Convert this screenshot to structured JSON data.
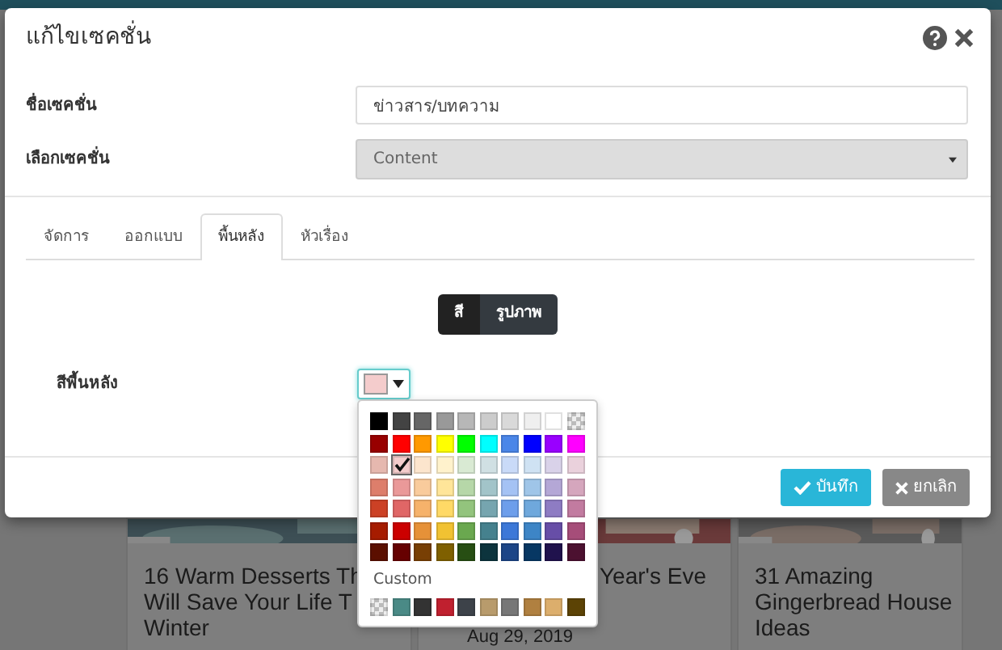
{
  "background_cards": [
    {
      "lines": [
        "16 Warm Desserts Th",
        "Will Save Your Life T",
        "Winter"
      ]
    },
    {
      "lines": [
        "Year's Eve"
      ],
      "date": "Aug 29, 2019"
    },
    {
      "lines": [
        "31 Amazing",
        "Gingerbread House",
        "Ideas"
      ]
    }
  ],
  "modal": {
    "title": "แก้ไขเซคชั่น",
    "fields": [
      {
        "label": "ชื่อเซคชั่น",
        "kind": "text",
        "value": "ข่าวสาร/บทความ"
      },
      {
        "label": "เลือกเซคชั่น",
        "kind": "select",
        "value": "Content",
        "disabled": true
      }
    ],
    "tabs": [
      {
        "label": "จัดการ",
        "selected": false
      },
      {
        "label": "ออกแบบ",
        "selected": false
      },
      {
        "label": "พื้นหลัง",
        "selected": true
      },
      {
        "label": "หัวเรื่อง",
        "selected": false
      }
    ],
    "mode_toggle": [
      {
        "label": "สี",
        "selected": true
      },
      {
        "label": "รูปภาพ",
        "selected": false
      }
    ],
    "background_color": {
      "label": "สีพื้นหลัง",
      "color": "#f4cccc",
      "expanded": true
    },
    "palette": {
      "rows": [
        [
          {
            "kind": "color",
            "color": "#000000",
            "selected": false
          },
          {
            "kind": "color",
            "color": "#434343",
            "selected": false
          },
          {
            "kind": "color",
            "color": "#666666",
            "selected": false
          },
          {
            "kind": "color",
            "color": "#999999",
            "selected": false
          },
          {
            "kind": "color",
            "color": "#b7b7b7",
            "selected": false
          },
          {
            "kind": "color",
            "color": "#cccccc",
            "selected": false
          },
          {
            "kind": "color",
            "color": "#d9d9d9",
            "selected": false
          },
          {
            "kind": "color",
            "color": "#efefef",
            "selected": false
          },
          {
            "kind": "color",
            "color": "#ffffff",
            "selected": false
          },
          {
            "kind": "transparent",
            "selected": false
          }
        ],
        [
          {
            "kind": "color",
            "color": "#980000",
            "selected": false
          },
          {
            "kind": "color",
            "color": "#ff0000",
            "selected": false
          },
          {
            "kind": "color",
            "color": "#ff9900",
            "selected": false
          },
          {
            "kind": "color",
            "color": "#ffff00",
            "selected": false
          },
          {
            "kind": "color",
            "color": "#00ff00",
            "selected": false
          },
          {
            "kind": "color",
            "color": "#00ffff",
            "selected": false
          },
          {
            "kind": "color",
            "color": "#4a86e8",
            "selected": false
          },
          {
            "kind": "color",
            "color": "#0000ff",
            "selected": false
          },
          {
            "kind": "color",
            "color": "#9900ff",
            "selected": false
          },
          {
            "kind": "color",
            "color": "#ff00ff",
            "selected": false
          }
        ],
        [
          {
            "kind": "color",
            "color": "#e6b8af",
            "selected": false
          },
          {
            "kind": "color",
            "color": "#f4cccc",
            "selected": true
          },
          {
            "kind": "color",
            "color": "#fce5cd",
            "selected": false
          },
          {
            "kind": "color",
            "color": "#fff2cc",
            "selected": false
          },
          {
            "kind": "color",
            "color": "#d9ead3",
            "selected": false
          },
          {
            "kind": "color",
            "color": "#d0e0e3",
            "selected": false
          },
          {
            "kind": "color",
            "color": "#c9daf8",
            "selected": false
          },
          {
            "kind": "color",
            "color": "#cfe2f3",
            "selected": false
          },
          {
            "kind": "color",
            "color": "#d9d2e9",
            "selected": false
          },
          {
            "kind": "color",
            "color": "#ead1dc",
            "selected": false
          }
        ],
        [
          {
            "kind": "color",
            "color": "#dd7e6b",
            "selected": false
          },
          {
            "kind": "color",
            "color": "#ea9999",
            "selected": false
          },
          {
            "kind": "color",
            "color": "#f9cb9c",
            "selected": false
          },
          {
            "kind": "color",
            "color": "#ffe599",
            "selected": false
          },
          {
            "kind": "color",
            "color": "#b6d7a8",
            "selected": false
          },
          {
            "kind": "color",
            "color": "#a2c4c9",
            "selected": false
          },
          {
            "kind": "color",
            "color": "#a4c2f4",
            "selected": false
          },
          {
            "kind": "color",
            "color": "#9fc5e8",
            "selected": false
          },
          {
            "kind": "color",
            "color": "#b4a7d6",
            "selected": false
          },
          {
            "kind": "color",
            "color": "#d5a6bd",
            "selected": false
          }
        ],
        [
          {
            "kind": "color",
            "color": "#cc4125",
            "selected": false
          },
          {
            "kind": "color",
            "color": "#e06666",
            "selected": false
          },
          {
            "kind": "color",
            "color": "#f6b26b",
            "selected": false
          },
          {
            "kind": "color",
            "color": "#ffd966",
            "selected": false
          },
          {
            "kind": "color",
            "color": "#93c47d",
            "selected": false
          },
          {
            "kind": "color",
            "color": "#76a5af",
            "selected": false
          },
          {
            "kind": "color",
            "color": "#6d9eeb",
            "selected": false
          },
          {
            "kind": "color",
            "color": "#6fa8dc",
            "selected": false
          },
          {
            "kind": "color",
            "color": "#8e7cc3",
            "selected": false
          },
          {
            "kind": "color",
            "color": "#c27ba0",
            "selected": false
          }
        ],
        [
          {
            "kind": "color",
            "color": "#a61c00",
            "selected": false
          },
          {
            "kind": "color",
            "color": "#cc0000",
            "selected": false
          },
          {
            "kind": "color",
            "color": "#e69138",
            "selected": false
          },
          {
            "kind": "color",
            "color": "#f1c232",
            "selected": false
          },
          {
            "kind": "color",
            "color": "#6aa84f",
            "selected": false
          },
          {
            "kind": "color",
            "color": "#45818e",
            "selected": false
          },
          {
            "kind": "color",
            "color": "#3c78d8",
            "selected": false
          },
          {
            "kind": "color",
            "color": "#3d85c6",
            "selected": false
          },
          {
            "kind": "color",
            "color": "#674ea7",
            "selected": false
          },
          {
            "kind": "color",
            "color": "#a64d79",
            "selected": false
          }
        ],
        [
          {
            "kind": "color",
            "color": "#5b0f00",
            "selected": false
          },
          {
            "kind": "color",
            "color": "#660000",
            "selected": false
          },
          {
            "kind": "color",
            "color": "#783f04",
            "selected": false
          },
          {
            "kind": "color",
            "color": "#7f6000",
            "selected": false
          },
          {
            "kind": "color",
            "color": "#274e13",
            "selected": false
          },
          {
            "kind": "color",
            "color": "#0c343d",
            "selected": false
          },
          {
            "kind": "color",
            "color": "#1c4587",
            "selected": false
          },
          {
            "kind": "color",
            "color": "#073763",
            "selected": false
          },
          {
            "kind": "color",
            "color": "#20124d",
            "selected": false
          },
          {
            "kind": "color",
            "color": "#4c1130",
            "selected": false
          }
        ]
      ],
      "custom_label": "Custom",
      "custom": [
        {
          "kind": "transparent",
          "selected": false
        },
        {
          "kind": "color",
          "color": "#4a8a86",
          "selected": false
        },
        {
          "kind": "color",
          "color": "#333333",
          "selected": false
        },
        {
          "kind": "color",
          "color": "#c0202f",
          "selected": false
        },
        {
          "kind": "color",
          "color": "#3d4249",
          "selected": false
        },
        {
          "kind": "color",
          "color": "#b89b6c",
          "selected": false
        },
        {
          "kind": "color",
          "color": "#777777",
          "selected": false
        },
        {
          "kind": "color",
          "color": "#b08040",
          "selected": false
        },
        {
          "kind": "color",
          "color": "#dcae6c",
          "selected": false
        },
        {
          "kind": "color",
          "color": "#5c4305",
          "selected": false
        }
      ]
    },
    "buttons": [
      {
        "label": "บันทึก",
        "kind": "save"
      },
      {
        "label": "ยกเลิก",
        "kind": "cancel"
      }
    ]
  }
}
